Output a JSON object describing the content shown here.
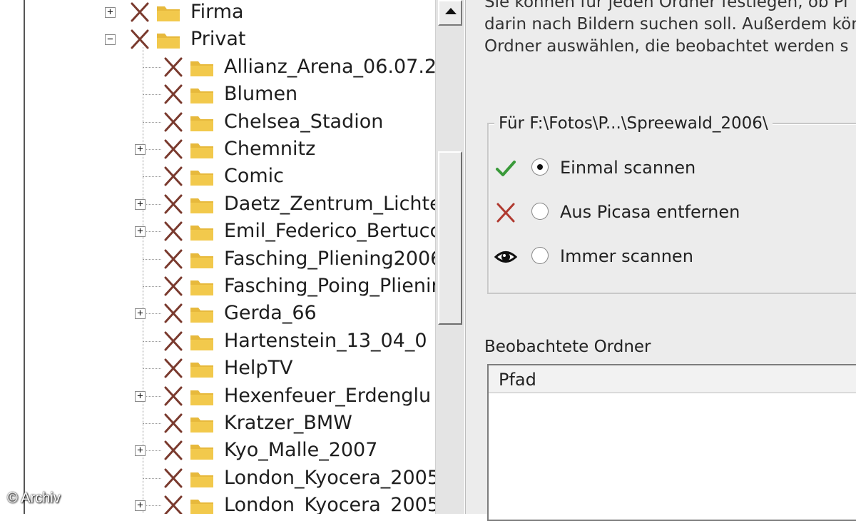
{
  "tree": {
    "top_items": [
      {
        "label": "Firma",
        "expander": "+"
      },
      {
        "label": "Privat",
        "expander": "−"
      }
    ],
    "children": [
      {
        "label": "Allianz_Arena_06.07.2",
        "expander": ""
      },
      {
        "label": "Blumen",
        "expander": ""
      },
      {
        "label": "Chelsea_Stadion",
        "expander": ""
      },
      {
        "label": "Chemnitz",
        "expander": "+"
      },
      {
        "label": "Comic",
        "expander": ""
      },
      {
        "label": "Daetz_Zentrum_Lichte",
        "expander": "+"
      },
      {
        "label": "Emil_Federico_Bertucc",
        "expander": "+"
      },
      {
        "label": "Fasching_Pliening2006",
        "expander": ""
      },
      {
        "label": "Fasching_Poing_Plienir",
        "expander": ""
      },
      {
        "label": "Gerda_66",
        "expander": "+"
      },
      {
        "label": "Hartenstein_13_04_0",
        "expander": ""
      },
      {
        "label": "HelpTV",
        "expander": ""
      },
      {
        "label": "Hexenfeuer_Erdenglu",
        "expander": "+"
      },
      {
        "label": "Kratzer_BMW",
        "expander": ""
      },
      {
        "label": "Kyo_Malle_2007",
        "expander": "+"
      },
      {
        "label": "London_Kyocera_2005",
        "expander": ""
      },
      {
        "label": "London_Kyocera_2005",
        "expander": "+"
      }
    ]
  },
  "description": {
    "line1": "Sie können für jeden Ordner festlegen, ob Pi",
    "line2": "darin nach Bildern suchen soll. Außerdem kön",
    "line3": "Ordner auswählen, die beobachtet werden s"
  },
  "scan_group": {
    "legend": "Für F:\\Fotos\\P...\\Spreewald_2006\\",
    "options": [
      {
        "label": "Einmal scannen",
        "checked": true,
        "icon": "checkmark-icon"
      },
      {
        "label": "Aus Picasa entfernen",
        "checked": false,
        "icon": "x-icon"
      },
      {
        "label": "Immer scannen",
        "checked": false,
        "icon": "eye-icon"
      }
    ]
  },
  "watched_folders": {
    "title": "Beobachtete Ordner",
    "column_header": "Pfad"
  },
  "watermark": "© Archiv",
  "colors": {
    "x_mark": "#7a3a2e",
    "checkmark": "#3a9a3a",
    "folder": "#f2c94c",
    "panel_bg": "#ececec"
  }
}
